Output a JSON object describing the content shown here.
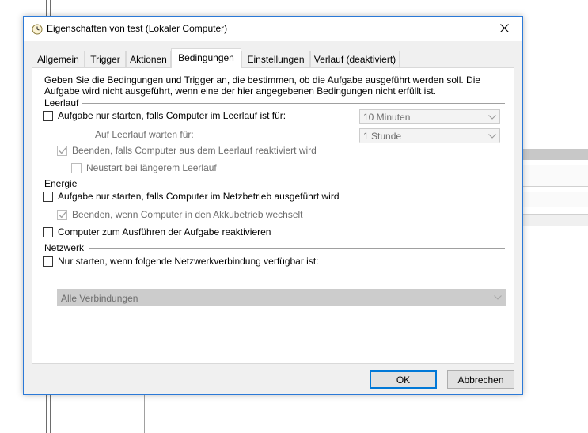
{
  "dialog": {
    "title": "Eigenschaften von test (Lokaler Computer)",
    "icon": "clock-icon",
    "close_icon": "close-icon"
  },
  "tabs": [
    {
      "label": "Allgemein",
      "active": false
    },
    {
      "label": "Trigger",
      "active": false
    },
    {
      "label": "Aktionen",
      "active": false
    },
    {
      "label": "Bedingungen",
      "active": true
    },
    {
      "label": "Einstellungen",
      "active": false
    },
    {
      "label": "Verlauf (deaktiviert)",
      "active": false
    }
  ],
  "conditions": {
    "intro": "Geben Sie die Bedingungen und Trigger an, die bestimmen, ob die Aufgabe ausgeführt werden soll. Die Aufgabe wird nicht ausgeführt, wenn eine der hier angegebenen Bedingungen nicht erfüllt ist.",
    "idle": {
      "group_label": "Leerlauf",
      "start_only_idle": {
        "label": "Aufgabe nur starten, falls Computer im Leerlauf ist für:",
        "checked": false,
        "enabled": true
      },
      "idle_duration": {
        "value": "10 Minuten",
        "enabled": false
      },
      "wait_label": "Auf Leerlauf warten für:",
      "wait_duration": {
        "value": "1 Stunde",
        "enabled": false
      },
      "stop_on_idle_end": {
        "label": "Beenden, falls Computer aus dem Leerlauf reaktiviert wird",
        "checked": true,
        "enabled": false
      },
      "restart_on_idle": {
        "label": "Neustart bei längerem Leerlauf",
        "checked": false,
        "enabled": false
      }
    },
    "power": {
      "group_label": "Energie",
      "start_on_ac": {
        "label": "Aufgabe nur starten, falls Computer im Netzbetrieb ausgeführt wird",
        "checked": false,
        "enabled": true
      },
      "stop_on_battery": {
        "label": "Beenden, wenn Computer in den Akkubetrieb wechselt",
        "checked": true,
        "enabled": false
      },
      "wake_to_run": {
        "label": "Computer zum Ausführen der Aufgabe reaktivieren",
        "checked": false,
        "enabled": true
      }
    },
    "network": {
      "group_label": "Netzwerk",
      "start_if_network": {
        "label": "Nur starten, wenn folgende Netzwerkverbindung verfügbar ist:",
        "checked": false,
        "enabled": true
      },
      "connection": {
        "value": "Alle Verbindungen",
        "enabled": false
      }
    }
  },
  "buttons": {
    "ok": "OK",
    "cancel": "Abbrechen"
  },
  "colors": {
    "accent": "#0078d7",
    "dialog_border": "#2b79d7",
    "disabled_text": "#6d6d6d"
  }
}
